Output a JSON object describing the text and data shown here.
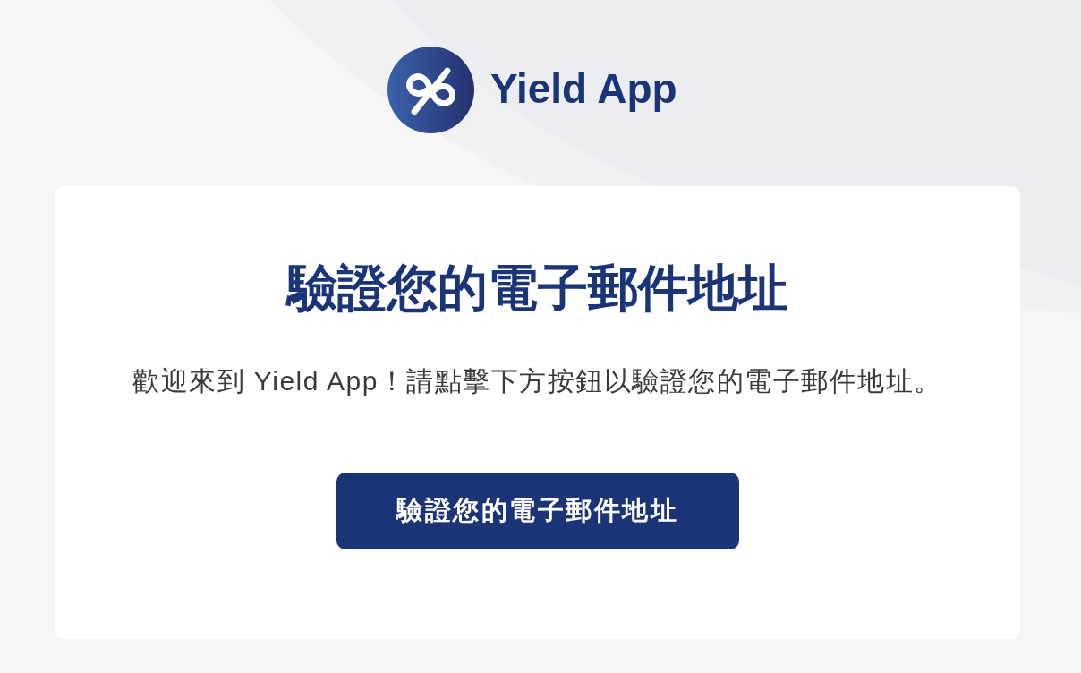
{
  "logo": {
    "text": "Yield App"
  },
  "card": {
    "title": "驗證您的電子郵件地址",
    "message": "歡迎來到 Yield App！請點擊下方按鈕以驗證您的電子郵件地址。",
    "button": "驗證您的電子郵件地址"
  }
}
